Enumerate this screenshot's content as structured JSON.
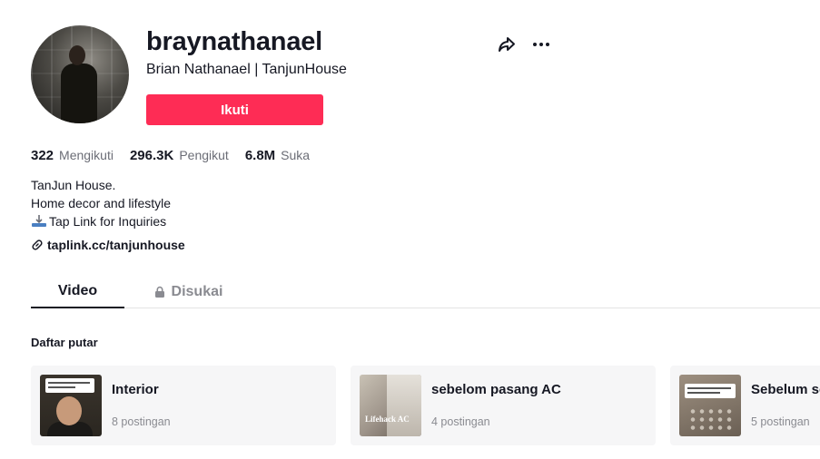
{
  "profile": {
    "username": "braynathanael",
    "nickname": "Brian Nathanael | TanjunHouse",
    "follow_label": "Ikuti"
  },
  "stats": [
    {
      "value": "322",
      "label": "Mengikuti"
    },
    {
      "value": "296.3K",
      "label": "Pengikut"
    },
    {
      "value": "6.8M",
      "label": "Suka"
    }
  ],
  "bio": {
    "lines": [
      "TanJun House.",
      "Home decor and lifestyle",
      "Tap Link for Inquiries"
    ],
    "link": "taplink.cc/tanjunhouse"
  },
  "tabs": {
    "video": "Video",
    "liked": "Disukai"
  },
  "playlists": {
    "title": "Daftar putar",
    "items": [
      {
        "title": "Interior",
        "count": "8 postingan",
        "thumb_text": ""
      },
      {
        "title": "sebelom pasang AC",
        "count": "4 postingan",
        "thumb_text": "Lifehack AC"
      },
      {
        "title": "Sebelum se",
        "count": "5 postingan",
        "thumb_text": ""
      }
    ]
  },
  "colors": {
    "accent": "#fe2c55",
    "text": "#161823",
    "muted": "#8a8b91"
  },
  "icons": {
    "share": "share-icon",
    "more": "more-icon",
    "link": "link-icon",
    "lock": "lock-icon",
    "inquiry": "point-down-icon"
  }
}
